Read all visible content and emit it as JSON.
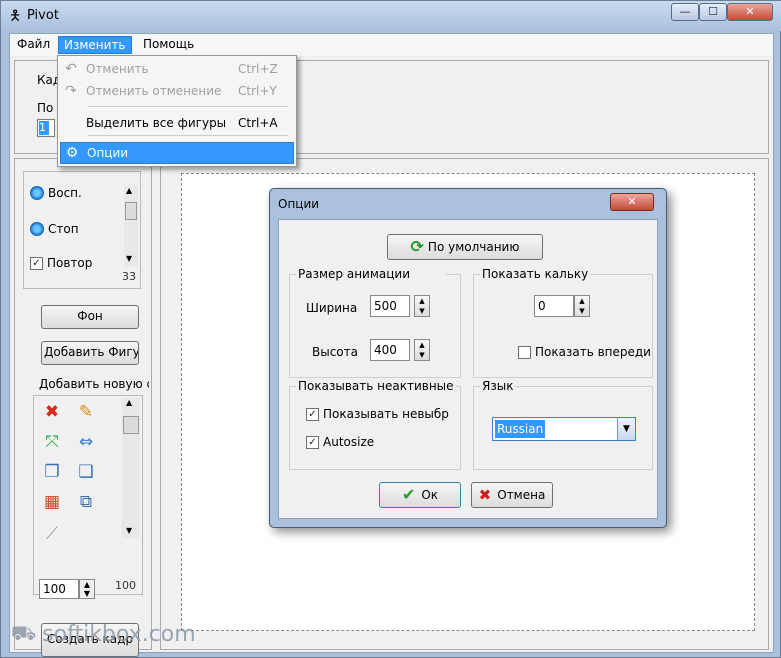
{
  "window": {
    "title": "Pivot",
    "app_icon": "stickman-icon",
    "min": "—",
    "max": "☐",
    "close": "✕"
  },
  "menubar": {
    "file": "Файл",
    "edit": "Изменить",
    "help": "Помощь"
  },
  "edit_menu": [
    {
      "icon": "undo-icon",
      "glyph": "↶",
      "label": "Отменить",
      "shortcut": "Ctrl+Z",
      "enabled": false
    },
    {
      "icon": "redo-icon",
      "glyph": "↷",
      "label": "Отменить отменение",
      "shortcut": "Ctrl+Y",
      "enabled": false
    },
    {
      "icon": "",
      "glyph": "",
      "label": "Выделить все фигуры",
      "shortcut": "Ctrl+A",
      "enabled": true
    },
    {
      "icon": "options-icon",
      "glyph": "⚙",
      "label": "Опции",
      "shortcut": "",
      "enabled": true,
      "highlighted": true
    }
  ],
  "top_panel": {
    "frames_label": "Кад",
    "position_label": "По",
    "frame_value": "1"
  },
  "left_panel": {
    "play_label": "Восп.",
    "stop_label": "Стоп",
    "repeat_label": "Повтор",
    "repeat_checked": true,
    "speed_value": "33",
    "bg_button": "Фон",
    "add_shape_button": "Добавить Фигуру",
    "add_new_label": "Добавить новую с",
    "tools": [
      {
        "name": "delete-icon",
        "glyph": "✖",
        "color": "#d62a1f"
      },
      {
        "name": "edit-pencil-icon",
        "glyph": "✎",
        "color": "#d98a1a"
      },
      {
        "name": "scale-icon",
        "glyph": "⤧",
        "color": "#2aa84a"
      },
      {
        "name": "flip-icon",
        "glyph": "⇔",
        "color": "#2a7fd4"
      },
      {
        "name": "bring-front-icon",
        "glyph": "❐",
        "color": "#3a6fb0"
      },
      {
        "name": "send-back-icon",
        "glyph": "❏",
        "color": "#3a6fb0"
      },
      {
        "name": "color-palette-icon",
        "glyph": "▦",
        "color": "#c8461f"
      },
      {
        "name": "copy-shape-icon",
        "glyph": "⧉",
        "color": "#3a6fb0"
      },
      {
        "name": "link-icon",
        "glyph": "⟋",
        "color": "#999999"
      }
    ],
    "size_value": "100",
    "size_max": "100",
    "create_frame_button": "Создать кадр"
  },
  "dialog": {
    "title": "Опции",
    "close": "✕",
    "defaults_button": "По умолчанию",
    "anim_group": "Размер анимации",
    "width_label": "Ширина",
    "width_value": "500",
    "height_label": "Высота",
    "height_value": "400",
    "tracing_group": "Показать кальку",
    "tracing_value": "0",
    "show_front_label": "Показать впереди",
    "show_front_checked": false,
    "inactive_group": "Показывать неактивные ф",
    "show_unselected_label": "Показывать невыбр",
    "show_unselected_checked": true,
    "autosize_label": "Autosize",
    "autosize_checked": true,
    "lang_group": "Язык",
    "lang_value": "Russian",
    "ok_button": "Ок",
    "cancel_button": "Отмена"
  },
  "watermark": {
    "text": "softikbox.com",
    "icon": "tray-icon"
  }
}
